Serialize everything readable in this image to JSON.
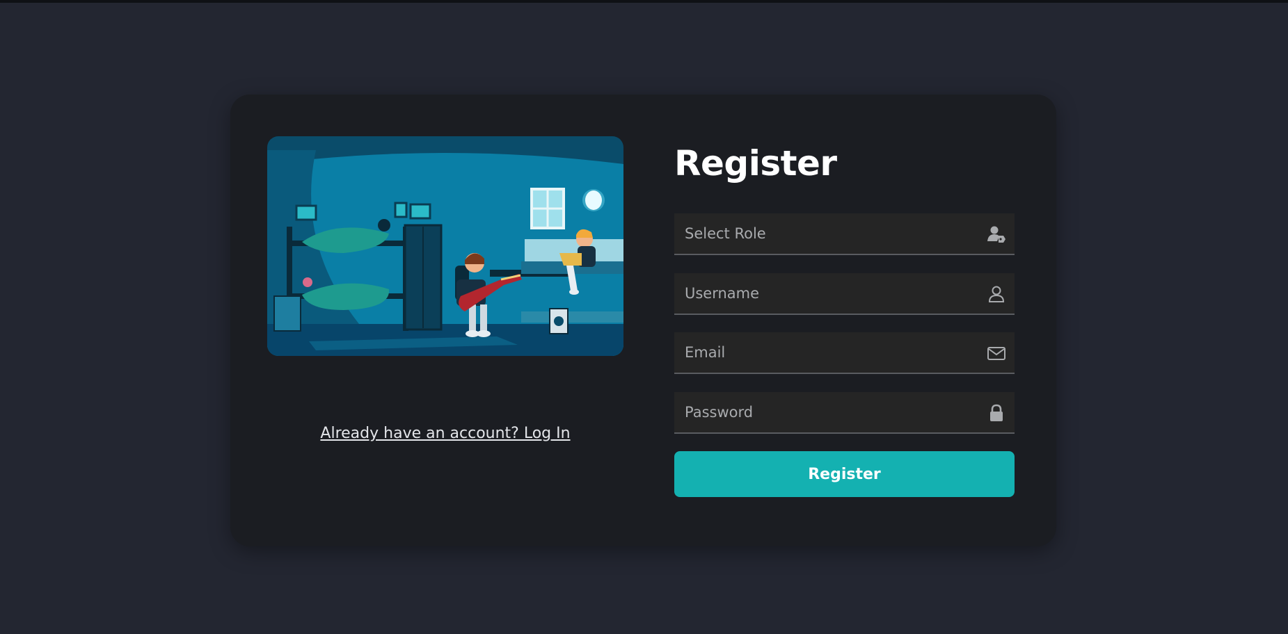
{
  "illustration": {
    "icon": "dorm-room-illustration"
  },
  "login_link": {
    "label": "Already have an account? Log In"
  },
  "form": {
    "title": "Register",
    "fields": [
      {
        "placeholder": "Select Role",
        "value": "",
        "icon": "user-tag-icon"
      },
      {
        "placeholder": "Username",
        "value": "",
        "icon": "user-icon"
      },
      {
        "placeholder": "Email",
        "value": "",
        "icon": "envelope-icon"
      },
      {
        "placeholder": "Password",
        "value": "",
        "icon": "lock-icon"
      }
    ],
    "submit_label": "Register"
  },
  "colors": {
    "page_bg": "#232631",
    "card_bg": "#1b1d22",
    "field_bg": "#252525",
    "accent": "#14b1b1",
    "text": "#ffffff"
  }
}
